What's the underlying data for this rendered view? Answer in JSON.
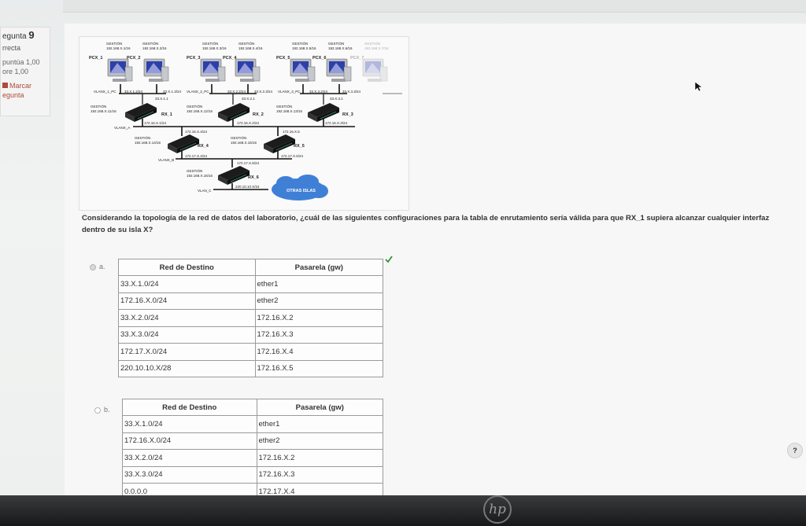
{
  "info": {
    "question_prefix": "egunta",
    "question_number": "9",
    "status": "rrecta",
    "score_line1": "puntúa 1,00",
    "score_line2": "ore 1,00",
    "flag_line1": "Marcar",
    "flag_line2": "egunta"
  },
  "topology": {
    "gestion": "GESTIÓN",
    "pcs": [
      {
        "name": "PCX_1",
        "ip": "192.168.X.1/16"
      },
      {
        "name": "PCX_2",
        "ip": "192.168.X.2/16"
      },
      {
        "name": "PCX_3",
        "ip": "192.168.X.3/16"
      },
      {
        "name": "PCX_4",
        "ip": "192.168.X.4/16"
      },
      {
        "name": "PCX_5",
        "ip": "192.168.X.5/16"
      },
      {
        "name": "PCX_6",
        "ip": "192.168.X.6/16"
      },
      {
        "name": "PCX_7",
        "ip": "192.168.X.7/16"
      }
    ],
    "vlan_pc": [
      "VLANX_1_PC",
      "VLANX_2_PC",
      "VLANX_3_PC"
    ],
    "lan_nets": [
      "33.X.1.2/24",
      "33.X.1.3/24",
      "33.X.2.2/24",
      "33.X.2.3/24",
      "33.X.3.2/24",
      "33.X.3.3/24"
    ],
    "router_nets": [
      "33.X.1.1",
      "33.X.2.1",
      "33.X.3.1"
    ],
    "routers": [
      {
        "name": "RX_1",
        "mgmt": "192.168.X.11/16"
      },
      {
        "name": "RX_2",
        "mgmt": "192.168.X.12/16"
      },
      {
        "name": "RX_3",
        "mgmt": "192.168.X.13/16"
      },
      {
        "name": "RX_4",
        "mgmt": "192.168.X.14/16"
      },
      {
        "name": "RX_5",
        "mgmt": "192.168.X.15/16"
      },
      {
        "name": "RX_6",
        "mgmt": "192.168.X.16/16"
      }
    ],
    "vlans": [
      "VLANX_A",
      "VLANX_B",
      "VLAN_C"
    ],
    "transit": [
      "172.16.X.1/24",
      "172.16.X.2/24",
      "172.16.X.3/24",
      "172.16.X.4/24",
      "172.16.X.5",
      "172.17.X.4/24",
      "172.17.X.5/24",
      "172.17.X.6/24",
      "220.10.10.X/24"
    ],
    "cloud": "OTRAS ISLAS"
  },
  "question": "Considerando la topología de la red de datos del laboratorio, ¿cuál de las siguientes configuraciones para la tabla de enrutamiento sería válida para que RX_1 supiera alcanzar cualquier interfaz dentro de su isla X?",
  "options": [
    {
      "letter": "a.",
      "header_dest": "Red de Destino",
      "header_gw": "Pasarela (gw)",
      "rows": [
        [
          "33.X.1.0/24",
          "ether1"
        ],
        [
          "172.16.X.0/24",
          "ether2"
        ],
        [
          "33.X.2.0/24",
          "172.16.X.2"
        ],
        [
          "33.X.3.0/24",
          "172.16.X.3"
        ],
        [
          "172.17.X.0/24",
          "172.16.X.4"
        ],
        [
          "220.10.10.X/28",
          "172.16.X.5"
        ]
      ]
    },
    {
      "letter": "b.",
      "header_dest": "Red de Destino",
      "header_gw": "Pasarela (gw)",
      "rows": [
        [
          "33.X.1.0/24",
          "ether1"
        ],
        [
          "172.16.X.0/24",
          "ether2"
        ],
        [
          "33.X.2.0/24",
          "172.16.X.2"
        ],
        [
          "33.X.3.0/24",
          "172.16.X.3"
        ],
        [
          "0.0.0.0",
          "172.17.X.4"
        ]
      ]
    }
  ],
  "help": "?",
  "brand": "hp",
  "colors": {
    "check": "#3a8f3a",
    "cloud": "#3f80d6",
    "flag": "#b04a3a"
  }
}
